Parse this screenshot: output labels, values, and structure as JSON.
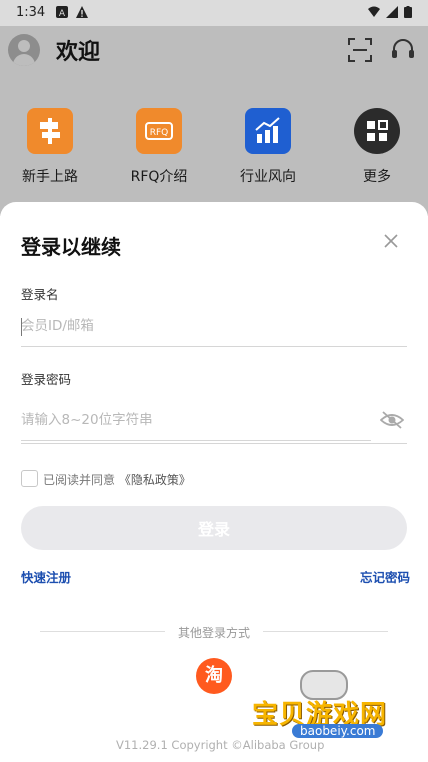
{
  "status_bar": {
    "time": "1:34"
  },
  "header": {
    "welcome": "欢迎"
  },
  "quick_links": [
    {
      "label": "新手上路",
      "icon": "signpost-icon",
      "color": "#f08a2c"
    },
    {
      "label": "RFQ介绍",
      "icon": "rfq-icon",
      "color": "#f08a2c"
    },
    {
      "label": "行业风向",
      "icon": "trend-chart-icon",
      "color": "#1f5fd1"
    },
    {
      "label": "更多",
      "icon": "grid-more-icon",
      "color": "#2b2b2b"
    }
  ],
  "login": {
    "title": "登录以继续",
    "username_label": "登录名",
    "username_placeholder": "会员ID/邮箱",
    "password_label": "登录密码",
    "password_placeholder": "请输入8~20位字符串",
    "agree_text": "已阅读并同意",
    "privacy_link": "《隐私政策》",
    "login_button": "登录",
    "quick_register": "快速注册",
    "forgot_password": "忘记密码",
    "other_methods": "其他登录方式",
    "taobao_icon_text": "淘",
    "version": "V11.29.1    Copyright ©Alibaba Group"
  },
  "watermark": {
    "title": "宝贝游戏网",
    "domain": "baobeiy.com"
  },
  "colors": {
    "accent_link": "#1d4fb0",
    "taobao": "#ff5a1f",
    "button_disabled": "#e9e9ec"
  }
}
